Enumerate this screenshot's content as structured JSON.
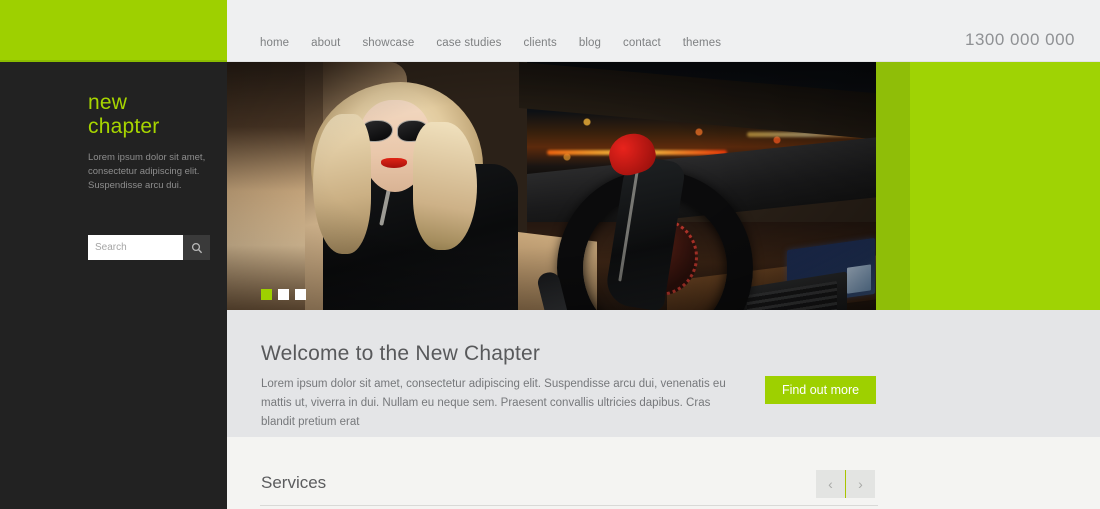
{
  "brand": {
    "logo_line1": "new",
    "logo_line2": "chapter",
    "accent_green": "#9ed000",
    "dark_bg": "#222222"
  },
  "header": {
    "nav": [
      {
        "label": "home"
      },
      {
        "label": "about"
      },
      {
        "label": "showcase"
      },
      {
        "label": "case studies"
      },
      {
        "label": "clients"
      },
      {
        "label": "blog"
      },
      {
        "label": "contact"
      },
      {
        "label": "themes"
      }
    ],
    "phone": "1300 000 000"
  },
  "sidebar": {
    "description": "Lorem ipsum dolor sit amet, consectetur adipiscing elit. Suspendisse arcu dui.",
    "search": {
      "placeholder": "Search",
      "value": "",
      "icon": "search-icon"
    }
  },
  "hero": {
    "slides": [
      {
        "index": 1,
        "active": true
      },
      {
        "index": 2,
        "active": false
      },
      {
        "index": 3,
        "active": false
      }
    ],
    "image_description": "Blonde woman wearing sunglasses and red lipstick sitting in a car at night with city lights"
  },
  "welcome": {
    "heading": "Welcome to the New Chapter",
    "paragraph": "Lorem ipsum dolor sit amet, consectetur adipiscing elit. Suspendisse arcu dui, venenatis eu mattis ut, viverra in dui. Nullam eu neque sem. Praesent convallis ultricies dapibus. Cras blandit pretium erat",
    "button_label": "Find out more"
  },
  "services": {
    "heading": "Services",
    "prev_icon": "chevron-left-icon",
    "next_icon": "chevron-right-icon",
    "prev_label": "‹",
    "next_label": "›"
  }
}
